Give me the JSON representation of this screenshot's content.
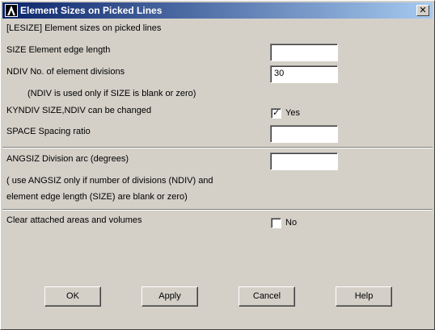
{
  "window": {
    "title": "Element Sizes on Picked Lines",
    "close_glyph": "✕"
  },
  "header": {
    "text": "[LESIZE]  Element sizes on picked lines"
  },
  "size": {
    "label": "SIZE    Element edge length",
    "value": ""
  },
  "ndiv": {
    "label": "NDIV    No. of element divisions",
    "value": "30",
    "note": "(NDIV is used only if SIZE is blank or zero)"
  },
  "kyndiv": {
    "label": "KYNDIV  SIZE,NDIV can be changed",
    "checked": true,
    "option_label": "Yes"
  },
  "space": {
    "label": "SPACE   Spacing ratio",
    "value": ""
  },
  "angsiz": {
    "label": "ANGSIZ  Division arc (degrees)",
    "value": "",
    "note1": "( use ANGSIZ only if number of divisions (NDIV) and",
    "note2": "element edge length (SIZE) are blank or zero)"
  },
  "clear": {
    "label": "Clear attached areas and volumes",
    "checked": false,
    "option_label": "No"
  },
  "buttons": {
    "ok": "OK",
    "apply": "Apply",
    "cancel": "Cancel",
    "help": "Help"
  },
  "icons": {
    "app": "ansys-logo-icon",
    "close": "close-icon",
    "check": "check-icon"
  }
}
